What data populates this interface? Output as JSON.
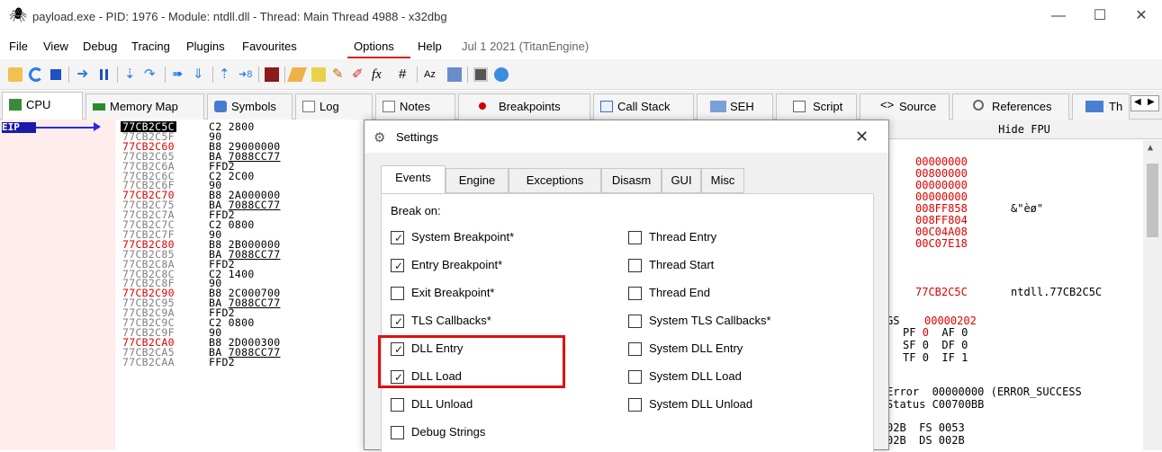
{
  "window": {
    "title": "payload.exe - PID: 1976 - Module: ntdll.dll - Thread: Main Thread 4988 - x32dbg",
    "minimize": "—",
    "maximize": "☐",
    "close": "✕"
  },
  "menu": {
    "items": [
      "File",
      "View",
      "Debug",
      "Tracing",
      "Plugins",
      "Favourites",
      "Options",
      "Help",
      "Jul 1 2021 (TitanEngine)"
    ],
    "highlight_color": "#e01010"
  },
  "tabs": [
    "CPU",
    "Memory Map",
    "Symbols",
    "Log",
    "Notes",
    "Breakpoints",
    "Call Stack",
    "SEH",
    "Script",
    "Source",
    "References",
    "Th"
  ],
  "eip_label": "EIP",
  "disasm": [
    {
      "addr": "77CB2C5C",
      "bytes": "C2 2800",
      "red": false,
      "current": true,
      "u": false
    },
    {
      "addr": "77CB2C5F",
      "bytes": "90",
      "red": false,
      "current": false,
      "u": false
    },
    {
      "addr": "77CB2C60",
      "bytes": "B8 29000000",
      "red": true,
      "current": false,
      "u": false
    },
    {
      "addr": "77CB2C65",
      "bytes": "BA 7088CC77",
      "red": false,
      "current": false,
      "u": true
    },
    {
      "addr": "77CB2C6A",
      "bytes": "FFD2",
      "red": false,
      "current": false,
      "u": false
    },
    {
      "addr": "77CB2C6C",
      "bytes": "C2 2C00",
      "red": false,
      "current": false,
      "u": false
    },
    {
      "addr": "77CB2C6F",
      "bytes": "90",
      "red": false,
      "current": false,
      "u": false
    },
    {
      "addr": "77CB2C70",
      "bytes": "B8 2A000000",
      "red": true,
      "current": false,
      "u": false
    },
    {
      "addr": "77CB2C75",
      "bytes": "BA 7088CC77",
      "red": false,
      "current": false,
      "u": true
    },
    {
      "addr": "77CB2C7A",
      "bytes": "FFD2",
      "red": false,
      "current": false,
      "u": false
    },
    {
      "addr": "77CB2C7C",
      "bytes": "C2 0800",
      "red": false,
      "current": false,
      "u": false
    },
    {
      "addr": "77CB2C7F",
      "bytes": "90",
      "red": false,
      "current": false,
      "u": false
    },
    {
      "addr": "77CB2C80",
      "bytes": "B8 2B000000",
      "red": true,
      "current": false,
      "u": false
    },
    {
      "addr": "77CB2C85",
      "bytes": "BA 7088CC77",
      "red": false,
      "current": false,
      "u": true
    },
    {
      "addr": "77CB2C8A",
      "bytes": "FFD2",
      "red": false,
      "current": false,
      "u": false
    },
    {
      "addr": "77CB2C8C",
      "bytes": "C2 1400",
      "red": false,
      "current": false,
      "u": false
    },
    {
      "addr": "77CB2C8F",
      "bytes": "90",
      "red": false,
      "current": false,
      "u": false
    },
    {
      "addr": "77CB2C90",
      "bytes": "B8 2C000700",
      "red": true,
      "current": false,
      "u": false
    },
    {
      "addr": "77CB2C95",
      "bytes": "BA 7088CC77",
      "red": false,
      "current": false,
      "u": true
    },
    {
      "addr": "77CB2C9A",
      "bytes": "FFD2",
      "red": false,
      "current": false,
      "u": false
    },
    {
      "addr": "77CB2C9C",
      "bytes": "C2 0800",
      "red": false,
      "current": false,
      "u": false
    },
    {
      "addr": "77CB2C9F",
      "bytes": "90",
      "red": false,
      "current": false,
      "u": false
    },
    {
      "addr": "77CB2CA0",
      "bytes": "B8 2D000300",
      "red": true,
      "current": false,
      "u": false
    },
    {
      "addr": "77CB2CA5",
      "bytes": "BA 7088CC77",
      "red": false,
      "current": false,
      "u": true
    },
    {
      "addr": "77CB2CAA",
      "bytes": "FFD2",
      "red": false,
      "current": false,
      "u": false
    }
  ],
  "registers": {
    "header": "Hide FPU",
    "values": [
      "00000000",
      "00800000",
      "00000000",
      "00000000",
      "008FF858",
      "008FF804",
      "00C04A08",
      "00C07E18"
    ],
    "ebx_comment": "&\"èø\"",
    "eip_value": "77CB2C5C",
    "eip_comment": "ntdll.77CB2C5C",
    "flags_label": "GS",
    "flags_value": "00000202",
    "flag_rows": [
      {
        "a_name": "PF",
        "a_val": "0",
        "b_name": "AF",
        "b_val": "0"
      },
      {
        "a_name": "SF",
        "a_val": "0",
        "b_name": "DF",
        "b_val": "0"
      },
      {
        "a_name": "TF",
        "a_val": "0",
        "b_name": "IF",
        "b_val": "1"
      }
    ],
    "last_error": "Error  00000000 (ERROR_SUCCESS",
    "last_status": "Status C00700BB",
    "seg_row1": "02B  FS 0053",
    "seg_row2": "02B  DS 002B"
  },
  "dialog": {
    "title": "Settings",
    "close": "✕",
    "tabs": [
      "Events",
      "Engine",
      "Exceptions",
      "Disasm",
      "GUI",
      "Misc"
    ],
    "break_on_label": "Break on:",
    "left_options": [
      {
        "label": "System Breakpoint*",
        "checked": true
      },
      {
        "label": "Entry Breakpoint*",
        "checked": true
      },
      {
        "label": "Exit Breakpoint*",
        "checked": false
      },
      {
        "label": "TLS Callbacks*",
        "checked": true
      },
      {
        "label": "DLL Entry",
        "checked": true
      },
      {
        "label": "DLL Load",
        "checked": true
      },
      {
        "label": "DLL Unload",
        "checked": false
      },
      {
        "label": "Debug Strings",
        "checked": false
      }
    ],
    "right_options": [
      {
        "label": "Thread Entry",
        "checked": false
      },
      {
        "label": "Thread Start",
        "checked": false
      },
      {
        "label": "Thread End",
        "checked": false
      },
      {
        "label": "System TLS Callbacks*",
        "checked": false
      },
      {
        "label": "System DLL Entry",
        "checked": false
      },
      {
        "label": "System DLL Load",
        "checked": false
      },
      {
        "label": "System DLL Unload",
        "checked": false
      }
    ]
  },
  "colors": {
    "red_text": "#e00000",
    "eip_bg": "#000000",
    "eip_fg": "#ffffff",
    "addr_gray": "#808080",
    "highlight_red": "#e01010"
  }
}
